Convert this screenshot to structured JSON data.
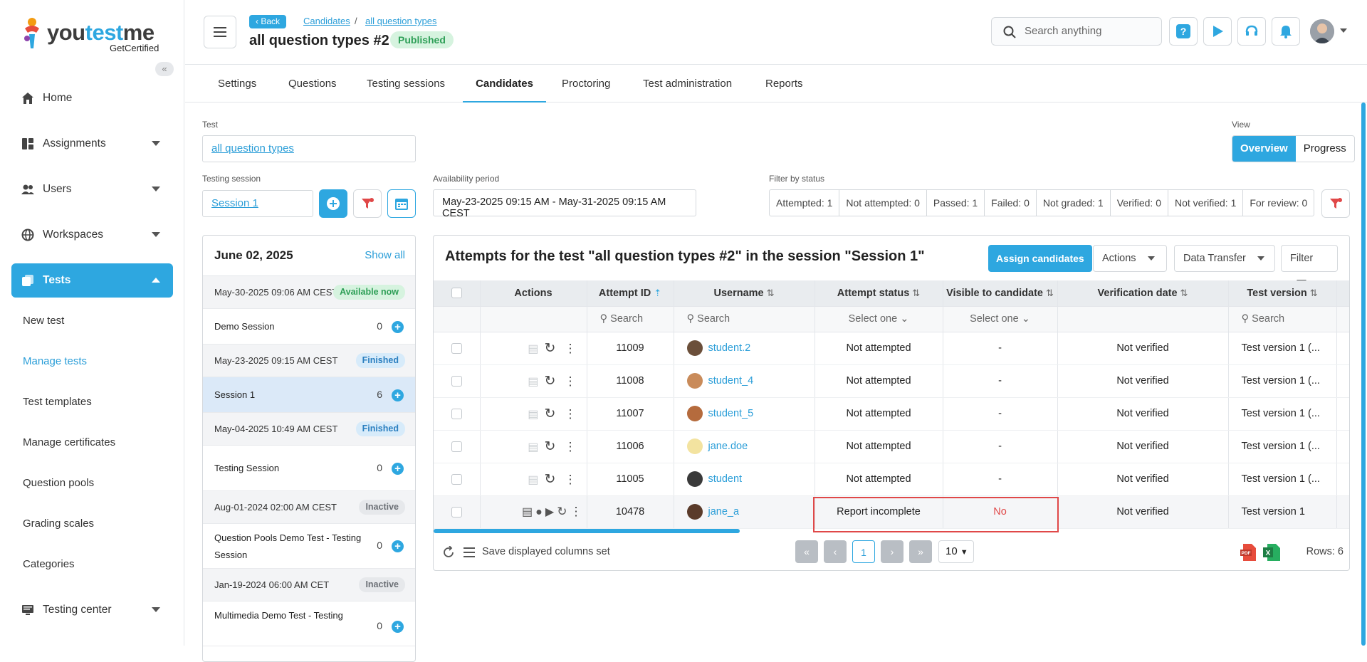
{
  "brand": {
    "name_a": "you",
    "name_b": "test",
    "name_c": "me",
    "tagline": "GetCertified"
  },
  "sidebar": {
    "items": [
      {
        "label": "Home",
        "icon": "home-icon"
      },
      {
        "label": "Assignments",
        "icon": "assignments-icon"
      },
      {
        "label": "Users",
        "icon": "users-icon"
      },
      {
        "label": "Workspaces",
        "icon": "globe-icon"
      },
      {
        "label": "Tests",
        "icon": "tests-icon",
        "active": true
      },
      {
        "label": "Testing center",
        "icon": "testing-center-icon"
      }
    ],
    "sub_items": [
      "New test",
      "Manage tests",
      "Test templates",
      "Manage certificates",
      "Question pools",
      "Grading scales",
      "Categories"
    ]
  },
  "header": {
    "back_label": "Back",
    "breadcrumbs": [
      "Candidates",
      "all question types "
    ],
    "crumb_sep": "/",
    "title": "all question types #2",
    "status_badge": "Published",
    "search_placeholder": "Search anything"
  },
  "tabs": [
    "Settings",
    "Questions",
    "Testing sessions",
    "Candidates",
    "Proctoring",
    "Test administration",
    "Reports"
  ],
  "filters": {
    "test_label": "Test",
    "test_value": "all question types ",
    "session_label": "Testing session",
    "session_value": "Session 1",
    "availability_label": "Availability period",
    "availability_value": "May-23-2025 09:15 AM - May-31-2025 09:15 AM CEST",
    "status_label": "Filter by status",
    "status_counts": [
      "Attempted: 1",
      "Not attempted: 0",
      "Passed: 1",
      "Failed: 0",
      "Not graded: 1",
      "Verified: 0",
      "Not verified: 1",
      "For review: 0"
    ],
    "view_label": "View",
    "view_options": [
      "Overview",
      "Progress"
    ]
  },
  "sessions": {
    "date": "June 02, 2025",
    "show_all": "Show all",
    "groups": [
      {
        "date": "May-30-2025 09:06 AM CEST",
        "badge": "Available now",
        "name": "Demo Session",
        "count": "0"
      },
      {
        "date": "May-23-2025 09:15 AM CEST",
        "badge": "Finished",
        "name": "Session 1",
        "count": "6"
      },
      {
        "date": "May-04-2025 10:49 AM CEST",
        "badge": "Finished",
        "name": "Testing  Session",
        "count": "0"
      },
      {
        "date": "Aug-01-2024 02:00 AM CEST",
        "badge": "Inactive",
        "name": "Question Pools Demo Test - Testing Session",
        "count": "0"
      },
      {
        "date": "Jan-19-2024 06:00 AM CET",
        "badge": "Inactive",
        "name": "Multimedia Demo Test - Testing",
        "count": "0"
      }
    ]
  },
  "grid": {
    "title": "Attempts for the test \"all question types #2\" in the session \"Session 1\"",
    "assign_label": "Assign candidates",
    "actions_label": "Actions",
    "data_transfer_label": "Data Transfer",
    "filter_label": "Filter",
    "columns": [
      "Actions",
      "Attempt ID",
      "Username",
      "Attempt status",
      "Visible to candidate",
      "Verification date",
      "Test version"
    ],
    "search_placeholder": "Search",
    "select_one": "Select one",
    "rows": [
      {
        "id": "11009",
        "user": "student.2",
        "status": "Not attempted",
        "visible": "-",
        "verification": "Not verified",
        "version": "Test version 1 (..."
      },
      {
        "id": "11008",
        "user": "student_4",
        "status": "Not attempted",
        "visible": "-",
        "verification": "Not verified",
        "version": "Test version 1 (..."
      },
      {
        "id": "11007",
        "user": "student_5",
        "status": "Not attempted",
        "visible": "-",
        "verification": "Not verified",
        "version": "Test version 1 (..."
      },
      {
        "id": "11006",
        "user": "jane.doe",
        "status": "Not attempted",
        "visible": "-",
        "verification": "Not verified",
        "version": "Test version 1 (..."
      },
      {
        "id": "11005",
        "user": "student",
        "status": "Not attempted",
        "visible": "-",
        "verification": "Not verified",
        "version": "Test version 1 (..."
      },
      {
        "id": "10478",
        "user": "jane_a",
        "status": "Report incomplete",
        "visible": "No",
        "verification": "Not verified",
        "version": "Test version 1"
      }
    ],
    "save_columns_label": "Save displayed columns set",
    "current_page": "1",
    "page_size": "10",
    "rows_label": "Rows: 6"
  },
  "colors": {
    "accent": "#2ea7e0",
    "highlight": "#e04848",
    "success": "#2e9f57"
  }
}
